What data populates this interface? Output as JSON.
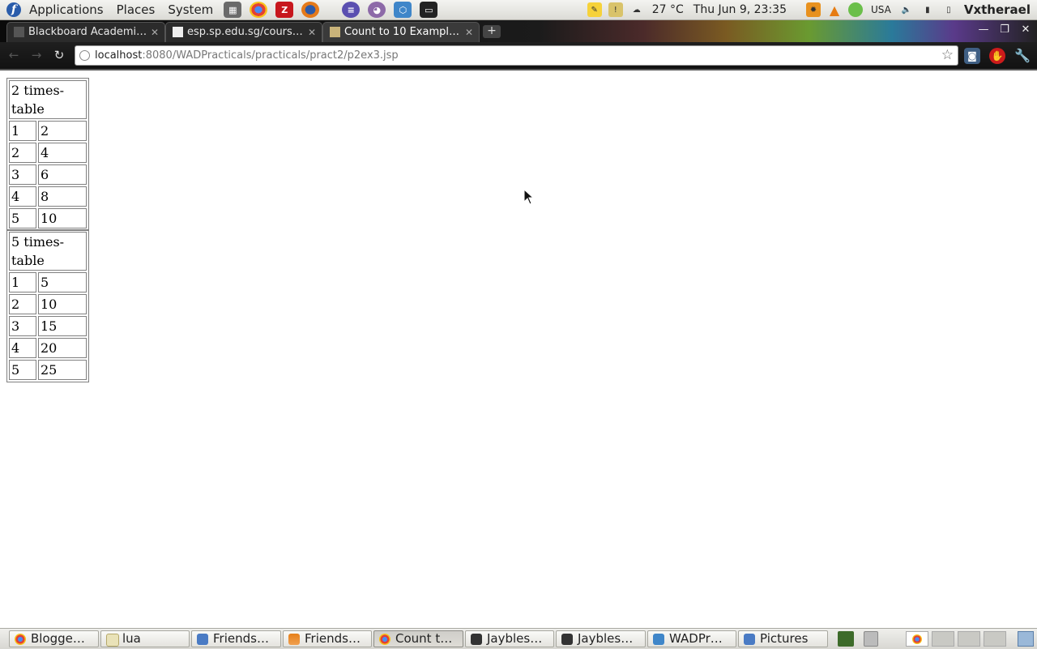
{
  "top_panel": {
    "menus": [
      "Applications",
      "Places",
      "System"
    ],
    "weather": "27 °C",
    "clock": "Thu Jun  9, 23:35",
    "keyboard_layout": "USA",
    "username": "Vxtherael"
  },
  "browser": {
    "tabs": [
      {
        "title": "Blackboard Academi…"
      },
      {
        "title": "esp.sp.edu.sg/cours…"
      },
      {
        "title": "Count to 10 Exampl…",
        "active": true
      }
    ],
    "url_host": "localhost",
    "url_rest": ":8080/WADPracticals/practicals/pract2/p2ex3.jsp"
  },
  "page": {
    "tables": [
      {
        "header": "2 times-table",
        "rows": [
          [
            "1",
            "2"
          ],
          [
            "2",
            "4"
          ],
          [
            "3",
            "6"
          ],
          [
            "4",
            "8"
          ],
          [
            "5",
            "10"
          ]
        ]
      },
      {
        "header": "5 times-table",
        "rows": [
          [
            "1",
            "5"
          ],
          [
            "2",
            "10"
          ],
          [
            "3",
            "15"
          ],
          [
            "4",
            "20"
          ],
          [
            "5",
            "25"
          ]
        ]
      }
    ]
  },
  "taskbar": {
    "tasks": [
      {
        "label": "Blogge…",
        "icon": "chrome-icon"
      },
      {
        "label": "lua",
        "icon": "text-editor-icon"
      },
      {
        "label": "Friends…",
        "icon": "folder-icon"
      },
      {
        "label": "Friends…",
        "icon": "vlc-icon"
      },
      {
        "label": "Count t…",
        "icon": "chrome-icon",
        "active": true
      },
      {
        "label": "Jaybles…",
        "icon": "terminal-icon"
      },
      {
        "label": "Jaybles…",
        "icon": "terminal-icon"
      },
      {
        "label": "WADPr…",
        "icon": "netbeans-icon"
      },
      {
        "label": "Pictures",
        "icon": "folder-icon"
      }
    ]
  },
  "colors": {
    "panel_bg": "#dcdbd6",
    "tab_strip_bg": "#1b1b1b",
    "page_bg": "#ffffff",
    "table_border": "#808080"
  }
}
